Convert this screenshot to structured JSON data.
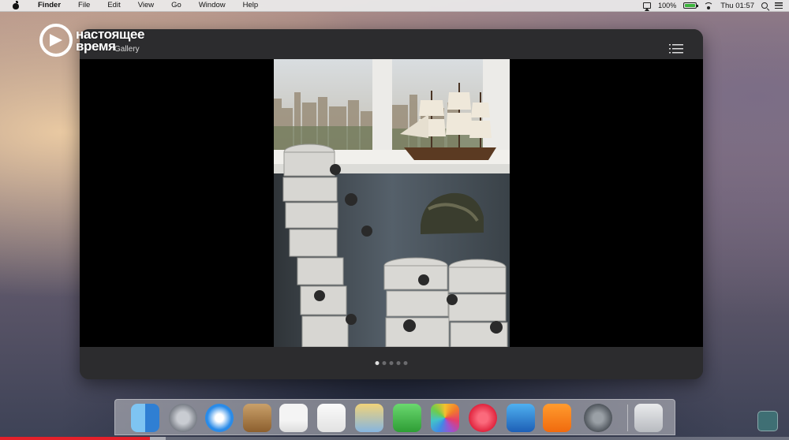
{
  "menubar": {
    "apple_icon": "apple-logo-icon",
    "app_name": "Finder",
    "menus": [
      "File",
      "Edit",
      "View",
      "Go",
      "Window",
      "Help"
    ],
    "battery_percent": "100%",
    "battery_level": 1.0,
    "clock": "Thu 01:57"
  },
  "channel_logo": {
    "line1": "настоящее",
    "line2": "время"
  },
  "gallery": {
    "title": "Gallery",
    "pager": {
      "count": 5,
      "active_index": 0
    }
  },
  "dock": {
    "apps": [
      "Finder",
      "Launchpad",
      "Safari",
      "Contacts",
      "Calendar",
      "Reminders",
      "Preview",
      "FaceTime",
      "Photos",
      "iTunes",
      "iMovie",
      "iBooks",
      "System Preferences",
      "Trash"
    ]
  },
  "video": {
    "played_fraction": 0.19,
    "buffered_fraction": 0.21
  },
  "colors": {
    "progress": "#e4202a",
    "gallery_bg": "#2a2a2c",
    "battery_fill": "#3cb43c"
  }
}
